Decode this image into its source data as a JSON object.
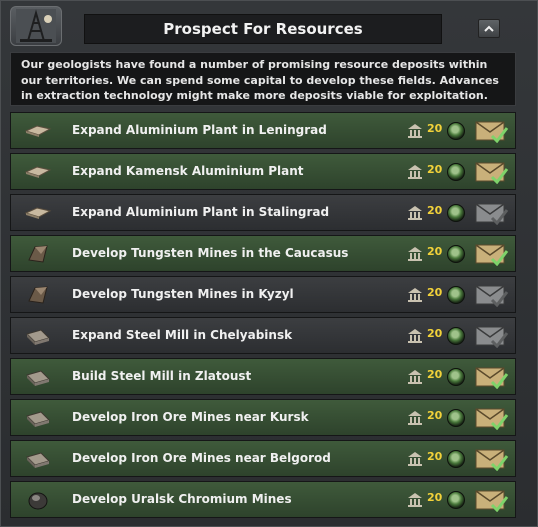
{
  "header": {
    "title": "Prospect For Resources",
    "logo_icon": "oil-derrick-icon",
    "collapse_icon": "chevron-up-icon"
  },
  "description": "Our geologists have found a number of promising resource deposits within our territories. We can spend some capital to develop these fields. Advances in extraction technology might make more deposits viable for exploitation.",
  "decisions": [
    {
      "label": "Expand Aluminium Plant in Leningrad",
      "cost": "20",
      "state": "available",
      "resource_icon": "aluminium-ingot-icon"
    },
    {
      "label": "Expand Kamensk Aluminium Plant",
      "cost": "20",
      "state": "available",
      "resource_icon": "aluminium-ingot-icon"
    },
    {
      "label": "Expand Aluminium Plant in Stalingrad",
      "cost": "20",
      "state": "unavailable",
      "resource_icon": "aluminium-ingot-icon"
    },
    {
      "label": "Develop Tungsten Mines in the Caucasus",
      "cost": "20",
      "state": "available",
      "resource_icon": "tungsten-ore-icon"
    },
    {
      "label": "Develop Tungsten Mines in Kyzyl",
      "cost": "20",
      "state": "unavailable",
      "resource_icon": "tungsten-ore-icon"
    },
    {
      "label": "Expand Steel Mill in Chelyabinsk",
      "cost": "20",
      "state": "unavailable",
      "resource_icon": "steel-ingot-icon"
    },
    {
      "label": "Build Steel Mill in Zlatoust",
      "cost": "20",
      "state": "available",
      "resource_icon": "steel-ingot-icon"
    },
    {
      "label": "Develop Iron Ore Mines near Kursk",
      "cost": "20",
      "state": "available",
      "resource_icon": "steel-ingot-icon"
    },
    {
      "label": "Develop Iron Ore Mines near Belgorod",
      "cost": "20",
      "state": "available",
      "resource_icon": "steel-ingot-icon"
    },
    {
      "label": "Develop Uralsk Chromium Mines",
      "cost": "20",
      "state": "available",
      "resource_icon": "chromium-ore-icon"
    }
  ],
  "colors": {
    "available_row": "#3f5a3b",
    "unavailable_row": "#3c3e41",
    "cost_text": "#f2d23a",
    "envelope_available": "#c9b07a",
    "envelope_unavailable": "#8a8c8e",
    "checkmark": "#7ed36a"
  },
  "icons": {
    "cost": "political-power-icon",
    "status": "green-orb-icon",
    "action_available": "envelope-checkmark-icon",
    "action_unavailable": "envelope-gray-icon"
  }
}
